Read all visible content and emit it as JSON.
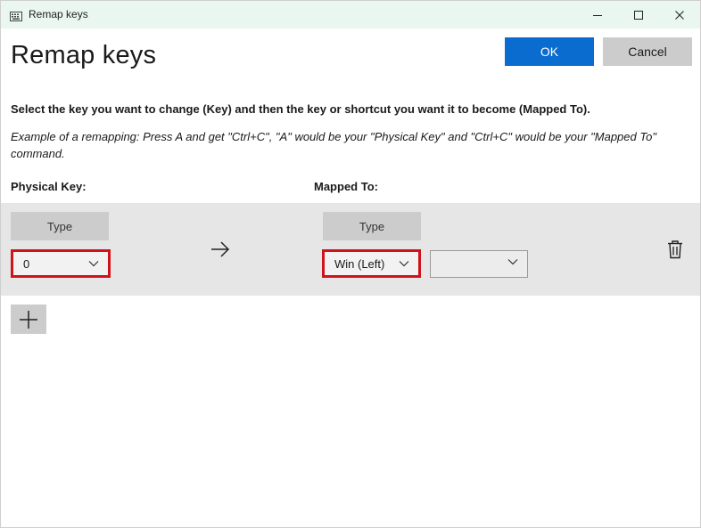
{
  "window": {
    "title": "Remap keys",
    "icon": "keyboard-icon"
  },
  "header": {
    "title": "Remap keys",
    "ok_label": "OK",
    "cancel_label": "Cancel"
  },
  "instructions": {
    "main": "Select the key you want to change (Key) and then the key or shortcut you want it to become (Mapped To).",
    "example": "Example of a remapping: Press A and get \"Ctrl+C\", \"A\" would be your \"Physical Key\" and \"Ctrl+C\" would be your \"Mapped To\" command."
  },
  "columns": {
    "physical": "Physical Key:",
    "mapped": "Mapped To:"
  },
  "mapping_row": {
    "physical_type_label": "Type",
    "physical_value": "0",
    "mapped_type_label": "Type",
    "mapped_value": "Win (Left)",
    "mapped_extra_value": ""
  },
  "colors": {
    "accent": "#0a6ccf",
    "highlight": "#d0121a",
    "titlebar": "#eaf6f0",
    "row_band": "#e6e6e6",
    "button_gray": "#cccccc"
  }
}
